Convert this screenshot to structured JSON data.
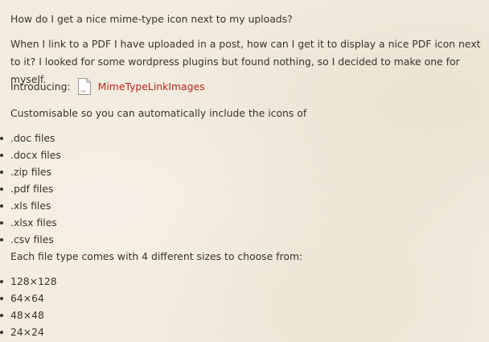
{
  "question": "How do I get a nice mime-type icon next to my uploads?",
  "intro": "When I link to a PDF I have uploaded in a post, how can I get it to display a nice PDF icon next to it? I looked for some wordpress plugins but found nothing, so I decided to make one for myself.",
  "introducing": {
    "label": "Introducing:",
    "link_text": "MimeTypeLinkImages",
    "icon": "pdf-file-icon",
    "link_color": "#b8261c"
  },
  "customisable": "Customisable so you can automatically include the icons of",
  "file_types": [
    ".doc files",
    ".docx files",
    ".zip files",
    ".pdf files",
    ".xls files",
    ".xlsx files",
    ".csv files"
  ],
  "sizes_intro": "Each file type comes with 4 different sizes to choose from:",
  "sizes": [
    "128×128",
    "64×64",
    "48×48",
    "24×24"
  ],
  "colors": {
    "background": "#f2ebdf",
    "text": "#3a3328",
    "link": "#b8261c"
  }
}
